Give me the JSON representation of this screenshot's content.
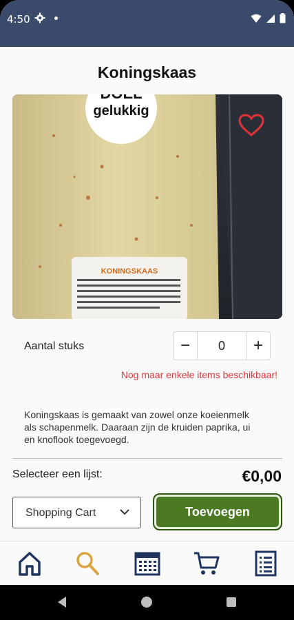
{
  "status": {
    "time": "4:50"
  },
  "product": {
    "title": "Koningskaas",
    "photo_label_top": "gelukkig",
    "photo_label_badge": "DOEL",
    "photo_sticker_title": "KONINGSKAAS",
    "quantity_label": "Aantal stuks",
    "quantity_value": "0",
    "minus": "−",
    "plus": "+",
    "stock_warning": "Nog maar enkele items beschikbaar!",
    "description": "Koningskaas is gemaakt van zowel onze koeienmelk als schapenmelk. Daaraan zijn de kruiden paprika, ui en knoflook toegevoegd.",
    "favorite": false
  },
  "cart": {
    "list_label": "Selecteer een lijst:",
    "price": "€0,00",
    "selected_list": "Shopping Cart",
    "add_button": "Toevoegen"
  },
  "tabs": [
    {
      "icon": "home-icon",
      "active": false
    },
    {
      "icon": "search-icon",
      "active": true
    },
    {
      "icon": "calendar-icon",
      "active": false
    },
    {
      "icon": "cart-icon",
      "active": false
    },
    {
      "icon": "list-icon",
      "active": false
    }
  ],
  "colors": {
    "header": "#3a4a6b",
    "accent_green": "#4c7a23",
    "warning_red": "#e0343a",
    "tab_navy": "#1f3560",
    "tab_active": "#d9a441"
  }
}
